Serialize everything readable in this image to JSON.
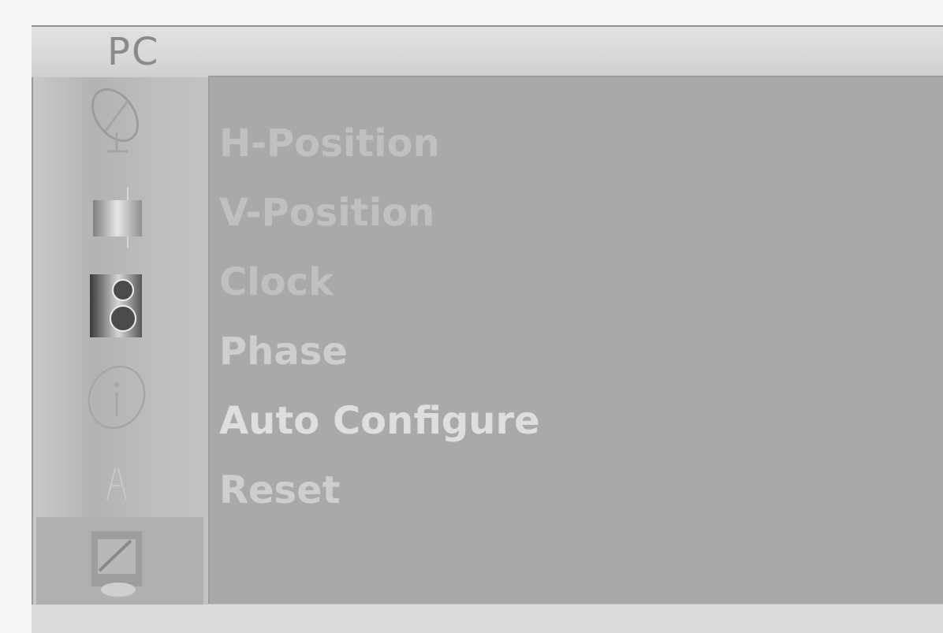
{
  "window": {
    "title": "PC"
  },
  "sidebar": {
    "icons": [
      {
        "name": "satellite-dish-icon"
      },
      {
        "name": "monitor-picture-icon"
      },
      {
        "name": "speaker-icon"
      },
      {
        "name": "info-icon"
      },
      {
        "name": "special-icon"
      },
      {
        "name": "pc-setup-icon",
        "selected": true
      }
    ]
  },
  "menu": {
    "items": [
      {
        "label": "H-Position"
      },
      {
        "label": "V-Position"
      },
      {
        "label": "Clock"
      },
      {
        "label": "Phase"
      },
      {
        "label": "Auto Configure",
        "highlighted": true
      },
      {
        "label": "Reset"
      }
    ]
  },
  "colors": {
    "panel": "#a9a9a9",
    "menu_text": "#c0c0c0",
    "highlight_text": "#dedede",
    "title_text": "#8a8a8a"
  }
}
